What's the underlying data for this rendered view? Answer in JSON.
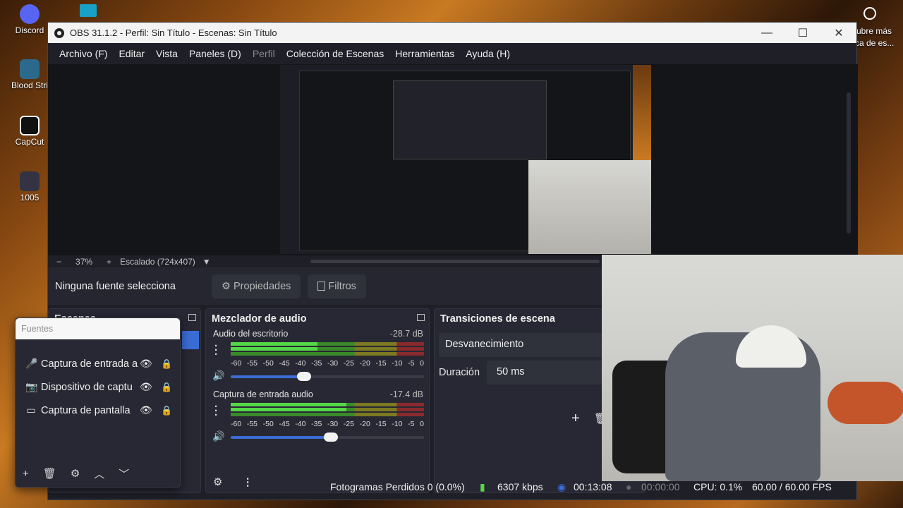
{
  "desktop": {
    "icons": [
      {
        "label": "Discord"
      },
      {
        "label": "Blood Stri"
      },
      {
        "label": "CapCut"
      },
      {
        "label": "1005"
      }
    ],
    "right_text_1": "cubre más",
    "right_text_2": "rca de es..."
  },
  "window": {
    "title": "OBS 31.1.2 - Perfil: Sin Título - Escenas: Sin Título",
    "minimize": "—",
    "maximize": "☐",
    "close": "✕"
  },
  "menu": [
    "Archivo (F)",
    "Editar",
    "Vista",
    "Paneles (D)",
    "Perfil",
    "Colección de Escenas",
    "Herramientas",
    "Ayuda (H)"
  ],
  "zoom": {
    "minus": "−",
    "value": "37%",
    "plus": "+",
    "scaling": "Escalado (724x407)"
  },
  "source_toolbar": {
    "no_selection": "Ninguna fuente selecciona",
    "properties": "Propiedades",
    "filters": "Filtros"
  },
  "scenes_panel": {
    "title": "Escenas"
  },
  "sources_panel": {
    "filter_placeholder": "Fuentes",
    "items": [
      {
        "label": "Captura de entrada a",
        "icon": "microphone-icon"
      },
      {
        "label": "Dispositivo de captu",
        "icon": "camera-icon"
      },
      {
        "label": "Captura de pantalla",
        "icon": "monitor-icon"
      }
    ]
  },
  "mixer": {
    "title": "Mezclador de audio",
    "scale": [
      "-60",
      "-55",
      "-50",
      "-45",
      "-40",
      "-35",
      "-30",
      "-25",
      "-20",
      "-15",
      "-10",
      "-5",
      "0"
    ],
    "tracks": [
      {
        "name": "Audio del escritorio",
        "db": "-28.7 dB",
        "level": 0.45,
        "volume": 0.38
      },
      {
        "name": "Captura de entrada audio",
        "db": "-17.4 dB",
        "level": 0.6,
        "volume": 0.52
      }
    ]
  },
  "transitions": {
    "title": "Transiciones de escena",
    "selected": "Desvanecimiento",
    "duration_label": "Duración",
    "duration_value": "50 ms"
  },
  "status": {
    "dropped": "Fotogramas Perdidos 0 (0.0%)",
    "bitrate": "6307 kbps",
    "stream_time": "00:13:08",
    "rec_time": "00:00:00",
    "cpu": "CPU: 0.1%",
    "fps": "60.00 / 60.00 FPS"
  },
  "colors": {
    "accent": "#3b6cd6",
    "meter_green": "#54d847",
    "panel_bg": "#272833"
  }
}
